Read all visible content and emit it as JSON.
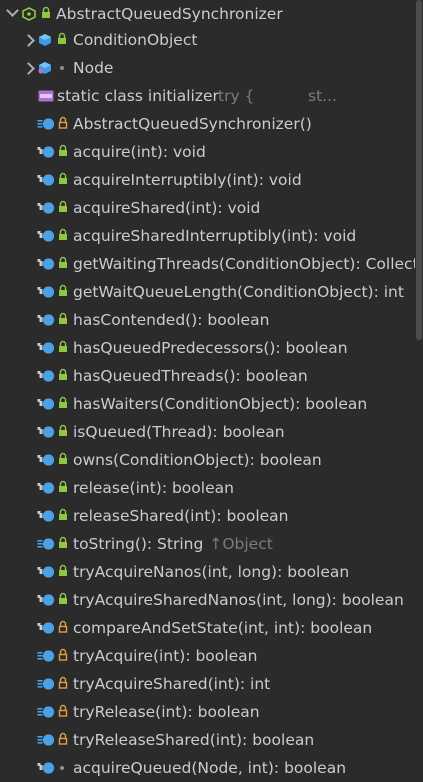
{
  "colors": {
    "background": "#2b2b2b",
    "text": "#c9ccd0",
    "gray_text": "#787c80",
    "class_icon": "#3c9be7",
    "method_icon": "#4aa1e6",
    "lock_green": "#8fc744",
    "lock_orange": "#e0a040",
    "static_icon": "#b070d0",
    "interface_green": "#8fc744"
  },
  "tree": {
    "root": {
      "label": "AbstractQueuedSynchronizer",
      "icon": "class-icon"
    },
    "children": [
      {
        "label": "ConditionObject",
        "icon": "inner-class-icon",
        "access": "public"
      },
      {
        "label": "Node",
        "icon": "static-inner-class-icon",
        "access": "package"
      }
    ],
    "initializer": {
      "label": "static class initializer",
      "hint_a": "try {",
      "hint_b": "st..."
    },
    "members": [
      {
        "label": "AbstractQueuedSynchronizer()",
        "access": "protected",
        "kind": "constructor"
      },
      {
        "label": "acquire(int): void",
        "access": "public",
        "kind": "final"
      },
      {
        "label": "acquireInterruptibly(int): void",
        "access": "public",
        "kind": "final"
      },
      {
        "label": "acquireShared(int): void",
        "access": "public",
        "kind": "final"
      },
      {
        "label": "acquireSharedInterruptibly(int): void",
        "access": "public",
        "kind": "final"
      },
      {
        "label": "getWaitingThreads(ConditionObject): Collection<Thread>",
        "access": "public",
        "kind": "final"
      },
      {
        "label": "getWaitQueueLength(ConditionObject): int",
        "access": "public",
        "kind": "final"
      },
      {
        "label": "hasContended(): boolean",
        "access": "public",
        "kind": "final"
      },
      {
        "label": "hasQueuedPredecessors(): boolean",
        "access": "public",
        "kind": "final"
      },
      {
        "label": "hasQueuedThreads(): boolean",
        "access": "public",
        "kind": "final"
      },
      {
        "label": "hasWaiters(ConditionObject): boolean",
        "access": "public",
        "kind": "final"
      },
      {
        "label": "isQueued(Thread): boolean",
        "access": "public",
        "kind": "final"
      },
      {
        "label": "owns(ConditionObject): boolean",
        "access": "public",
        "kind": "final"
      },
      {
        "label": "release(int): boolean",
        "access": "public",
        "kind": "final"
      },
      {
        "label": "releaseShared(int): boolean",
        "access": "public",
        "kind": "final"
      },
      {
        "label": "toString(): String",
        "access": "public",
        "kind": "method",
        "suffix": "↑Object"
      },
      {
        "label": "tryAcquireNanos(int, long): boolean",
        "access": "public",
        "kind": "final"
      },
      {
        "label": "tryAcquireSharedNanos(int, long): boolean",
        "access": "public",
        "kind": "final"
      },
      {
        "label": "compareAndSetState(int, int): boolean",
        "access": "protected",
        "kind": "final"
      },
      {
        "label": "tryAcquire(int): boolean",
        "access": "protected",
        "kind": "method"
      },
      {
        "label": "tryAcquireShared(int): int",
        "access": "protected",
        "kind": "method"
      },
      {
        "label": "tryRelease(int): boolean",
        "access": "protected",
        "kind": "method"
      },
      {
        "label": "tryReleaseShared(int): boolean",
        "access": "protected",
        "kind": "method"
      },
      {
        "label": "acquireQueued(Node, int): boolean",
        "access": "package",
        "kind": "final"
      }
    ]
  }
}
